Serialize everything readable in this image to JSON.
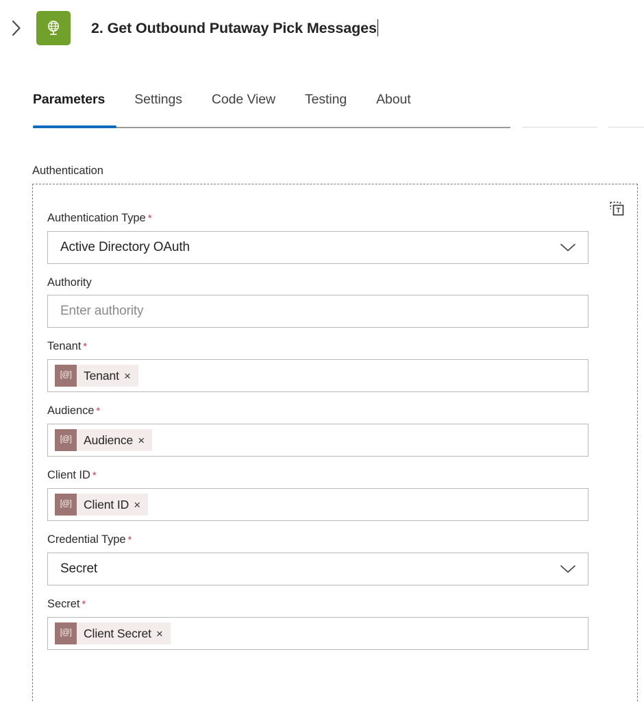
{
  "header": {
    "collapse_icon": "chevron-right-icon",
    "app_icon": "http-globe-icon",
    "app_icon_color": "#71a02b",
    "title": "2. Get Outbound Putaway Pick Messages",
    "title_has_caret": true
  },
  "tabs": {
    "items": [
      {
        "label": "Parameters",
        "active": true
      },
      {
        "label": "Settings",
        "active": false
      },
      {
        "label": "Code View",
        "active": false
      },
      {
        "label": "Testing",
        "active": false
      },
      {
        "label": "About",
        "active": false
      }
    ],
    "active_indicator_color": "#0f6cbd"
  },
  "section": {
    "label": "Authentication",
    "token_toggle_icon": "dynamic-content-text-icon"
  },
  "fields": [
    {
      "label": "Authentication Type",
      "required": true,
      "type": "dropdown",
      "value": "Active Directory OAuth",
      "chevron": "chevron-down-icon"
    },
    {
      "label": "Authority",
      "required": false,
      "type": "text",
      "value": "",
      "placeholder": "Enter authority"
    },
    {
      "label": "Tenant",
      "required": true,
      "type": "token",
      "token": {
        "icon": "[@]",
        "text": "Tenant",
        "remove": "×"
      }
    },
    {
      "label": "Audience",
      "required": true,
      "type": "token",
      "token": {
        "icon": "[@]",
        "text": "Audience",
        "remove": "×"
      }
    },
    {
      "label": "Client ID",
      "required": true,
      "type": "token",
      "token": {
        "icon": "[@]",
        "text": "Client ID",
        "remove": "×"
      }
    },
    {
      "label": "Credential Type",
      "required": true,
      "type": "dropdown",
      "value": "Secret",
      "chevron": "chevron-down-icon"
    },
    {
      "label": "Secret",
      "required": true,
      "type": "token",
      "token": {
        "icon": "[@]",
        "text": "Client Secret",
        "remove": "×"
      }
    }
  ],
  "colors": {
    "accent": "#0f6cbd",
    "required_asterisk": "#c4454d",
    "token_chip_icon_bg": "#9d7572",
    "token_chip_bg": "#f3eceb",
    "app_icon_bg": "#71a02b"
  }
}
